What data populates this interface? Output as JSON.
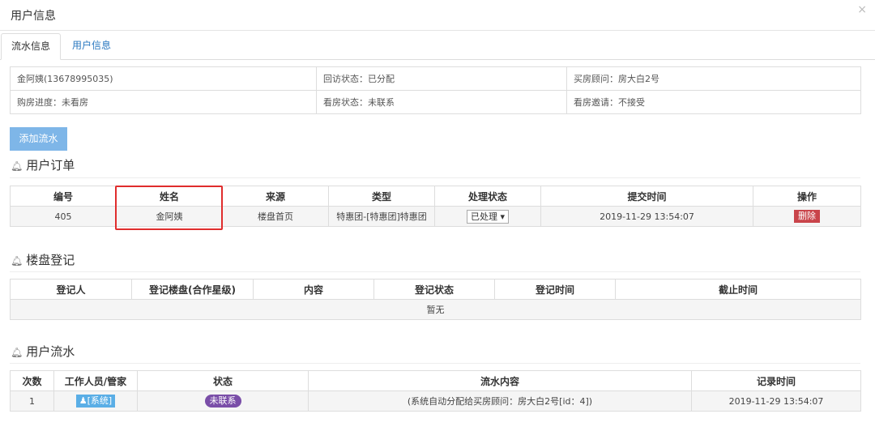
{
  "modal": {
    "title": "用户信息",
    "close": "×"
  },
  "tabs": [
    {
      "label": "流水信息"
    },
    {
      "label": "用户信息"
    }
  ],
  "info": {
    "row1": [
      "金阿姨(13678995035)",
      "回访状态：已分配",
      "买房顾问：房大白2号"
    ],
    "row2": [
      "购房进度：未看房",
      "看房状态：未联系",
      "看房邀请：不接受"
    ]
  },
  "add_button": "添加流水",
  "orders": {
    "title": "用户订单",
    "headers": [
      "编号",
      "姓名",
      "来源",
      "类型",
      "处理状态",
      "提交时间",
      "操作"
    ],
    "row": {
      "id": "405",
      "name": "金阿姨",
      "source": "楼盘首页",
      "type": "特惠团-[特惠团]特惠团",
      "status": "已处理",
      "time": "2019-11-29 13:54:07",
      "action": "删除"
    }
  },
  "registration": {
    "title": "楼盘登记",
    "headers": [
      "登记人",
      "登记楼盘(合作星级)",
      "内容",
      "登记状态",
      "登记时间",
      "截止时间"
    ],
    "empty": "暂无"
  },
  "flow": {
    "title": "用户流水",
    "headers": [
      "次数",
      "工作人员/管家",
      "状态",
      "流水内容",
      "记录时间"
    ],
    "row": {
      "count": "1",
      "staff": "[系统]",
      "status": "未联系",
      "content": "(系统自动分配给买房顾问：房大白2号[id：4])",
      "time": "2019-11-29 13:54:07"
    }
  },
  "colors": {
    "tab_link": "#2a78c0",
    "add_button": "#7eb6e8",
    "delete": "#c9444a",
    "highlight": "#e02d2d",
    "status_pill": "#7a4ea8",
    "staff_tag": "#5aaee6"
  }
}
